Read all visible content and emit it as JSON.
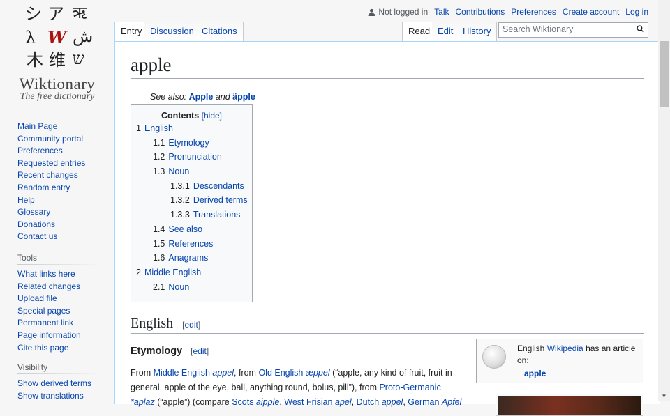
{
  "logo": {
    "glyphs": [
      "シ",
      "ア",
      "ऋ",
      "λ",
      "W",
      "ش",
      "木",
      "维",
      "ש"
    ],
    "title": "Wiktionary",
    "tagline": "The free dictionary"
  },
  "personal_tools": {
    "status": "Not logged in",
    "links": [
      "Talk",
      "Contributions",
      "Preferences",
      "Create account",
      "Log in"
    ]
  },
  "tabs": {
    "left": [
      "Entry",
      "Discussion",
      "Citations"
    ],
    "right": [
      "Read",
      "Edit",
      "History"
    ]
  },
  "search": {
    "placeholder": "Search Wiktionary"
  },
  "sidebar": {
    "navigation": [
      "Main Page",
      "Community portal",
      "Preferences",
      "Requested entries",
      "Recent changes",
      "Random entry",
      "Help",
      "Glossary",
      "Donations",
      "Contact us"
    ],
    "tools_heading": "Tools",
    "tools": [
      "What links here",
      "Related changes",
      "Upload file",
      "Special pages",
      "Permanent link",
      "Page information",
      "Cite this page"
    ],
    "visibility_heading": "Visibility",
    "visibility": [
      "Show derived terms",
      "Show translations"
    ]
  },
  "page": {
    "title": "apple",
    "see_also_prefix": "See also:",
    "see_also_1": "Apple",
    "see_also_and": "and",
    "see_also_2": "äpple"
  },
  "toc": {
    "title": "Contents",
    "hide": "[hide]",
    "items": [
      {
        "num": "1",
        "label": "English",
        "level": 1
      },
      {
        "num": "1.1",
        "label": "Etymology",
        "level": 2
      },
      {
        "num": "1.2",
        "label": "Pronunciation",
        "level": 2
      },
      {
        "num": "1.3",
        "label": "Noun",
        "level": 2
      },
      {
        "num": "1.3.1",
        "label": "Descendants",
        "level": 3
      },
      {
        "num": "1.3.2",
        "label": "Derived terms",
        "level": 3
      },
      {
        "num": "1.3.3",
        "label": "Translations",
        "level": 3
      },
      {
        "num": "1.4",
        "label": "See also",
        "level": 2
      },
      {
        "num": "1.5",
        "label": "References",
        "level": 2
      },
      {
        "num": "1.6",
        "label": "Anagrams",
        "level": 2
      },
      {
        "num": "2",
        "label": "Middle English",
        "level": 1
      },
      {
        "num": "2.1",
        "label": "Noun",
        "level": 2
      }
    ]
  },
  "sections": {
    "english": "English",
    "etymology": "Etymology",
    "edit_open": "[",
    "edit": "edit",
    "edit_close": "]"
  },
  "etymology": {
    "t1": "From ",
    "l1": "Middle English",
    "t2": " ",
    "w1": "appel",
    "t3": ", from ",
    "l2": "Old English",
    "t4": " ",
    "w2": "æppel",
    "t5": " (“apple, any kind of fruit, fruit in general, apple of the eye, ball, anything round, bolus, pill”), from ",
    "l3": "Proto-Germanic",
    "t6": " ",
    "w3": "*aplaz",
    "t7": " (“apple”) (compare ",
    "l4": "Scots",
    "w4": "aipple",
    "l5": "West Frisian",
    "w5": "apel",
    "l6": "Dutch",
    "w6": "appel",
    "l7": "German",
    "w7": "Apfel"
  },
  "wikipedia_box": {
    "prefix": "English",
    "link": "Wikipedia",
    "suffix": "has an article on:",
    "article": "apple"
  }
}
